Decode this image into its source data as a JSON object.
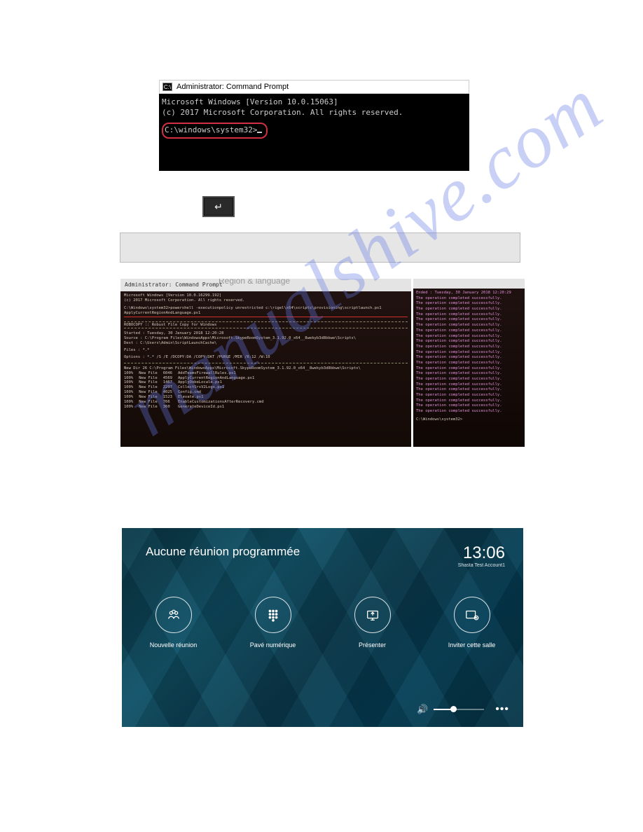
{
  "watermark": "manualshive.com",
  "cmd1": {
    "title": "Administrator: Command Prompt",
    "line1": "Microsoft Windows [Version 10.0.15063]",
    "line2": "(c) 2017 Microsoft Corporation. All rights reserved.",
    "prompt": "C:\\windows\\system32>"
  },
  "enter_key": "↵",
  "photo_left": {
    "title": "Administrator: Command Prompt",
    "bg_heading": "Region & language",
    "line1": "Microsoft Windows [Version 10.0.16299.192]",
    "line2": "(c) 2017 Microsoft Corporation. All rights reserved.",
    "cmd": "C:\\Windows\\system32>powershell -executionpolicy unrestricted c:\\rigel\\x64\\scripts\\provisioning\\scriptlaunch.ps1 ApplyCurrentRegionAndLanguage.ps1",
    "robocopy_header": "ROBOCOPY   ::   Robust File Copy for Windows",
    "started": "Started : Tuesday, 30 January 2018 12:20:28",
    "source": "Source : C:\\Program Files\\WindowsApps\\Microsoft.SkypeRoomSystem_3.1.92.0_x64__8wekyb3d8bbwe\\Scripts\\",
    "dest": "Dest : C:\\Users\\Admin\\ScriptLaunchCache\\",
    "files": "Files : *.*",
    "options": "Options : *.* /S /E /DCOPY:DA /COPY:DAT /PURGE /MIR /R:12 /W:10",
    "newdir": "New Dir          26    C:\\Program Files\\WindowsApps\\Microsoft.SkypeRoomSystem_3.1.92.0_x64__8wekyb3d8bbwe\\Scripts\\",
    "rows": [
      {
        "pct": "100%",
        "kind": "New File",
        "size": "6046",
        "name": "AddTeamsFirewallRules.ps1"
      },
      {
        "pct": "100%",
        "kind": "New File",
        "size": "4569",
        "name": "ApplyCurrentRegionAndLanguage.ps1"
      },
      {
        "pct": "100%",
        "kind": "New File",
        "size": "1467",
        "name": "ApplyOobeLocale.ps1"
      },
      {
        "pct": "100%",
        "kind": "New File",
        "size": "2297",
        "name": "CollectSrsV2Logs.ps1"
      },
      {
        "pct": "100%",
        "kind": "New File",
        "size": "4025",
        "name": "Config.cmd"
      },
      {
        "pct": "100%",
        "kind": "New File",
        "size": "1523",
        "name": "Elevate.ps1"
      },
      {
        "pct": "100%",
        "kind": "New File",
        "size": "766",
        "name": "EnableCustomizationsAfterRecovery.cmd"
      },
      {
        "pct": "100%",
        "kind": "New File",
        "size": "360",
        "name": "GenerateDeviceId.ps1"
      }
    ]
  },
  "photo_right": {
    "ended": "Ended : Tuesday, 30 January 2018 12:20:29",
    "success_line": "The operation completed successfully.",
    "success_count": 22,
    "prompt": "C:\\Windows\\system32>"
  },
  "panel": {
    "heading": "Aucune réunion programmée",
    "clock": "13:06",
    "account": "Shasta Test Account1",
    "buttons": [
      {
        "name": "new-meeting",
        "label": "Nouvelle réunion",
        "icon": "people"
      },
      {
        "name": "dialpad",
        "label": "Pavé numérique",
        "icon": "dialpad"
      },
      {
        "name": "present",
        "label": "Présenter",
        "icon": "present"
      },
      {
        "name": "invite",
        "label": "Inviter cette salle",
        "icon": "invite"
      }
    ],
    "more": "•••"
  }
}
